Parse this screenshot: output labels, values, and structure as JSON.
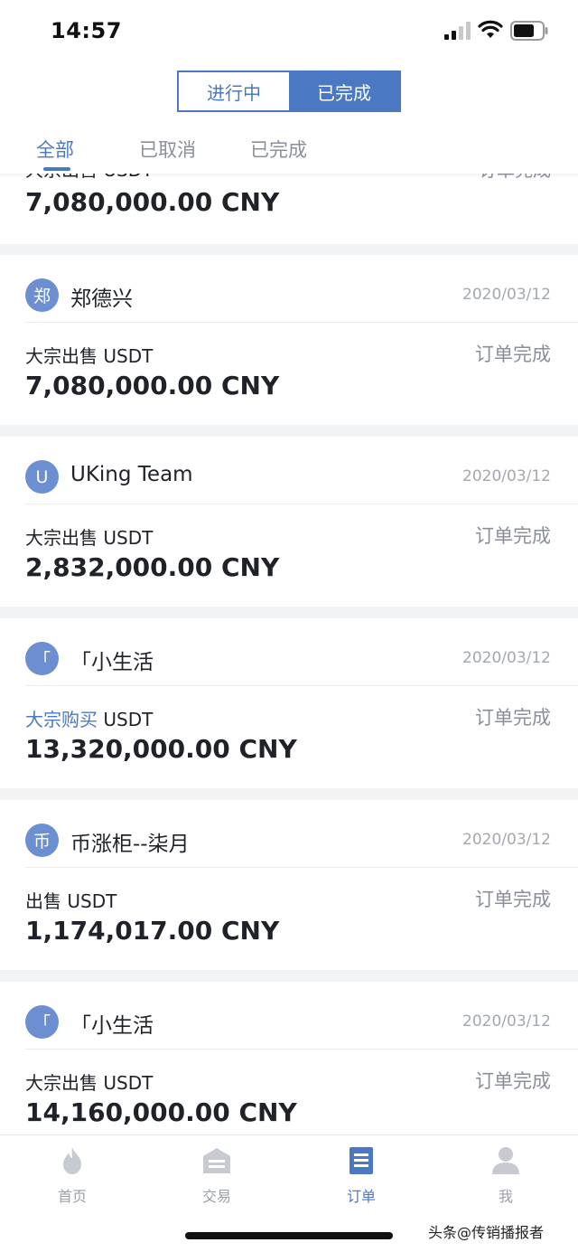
{
  "status_bar": {
    "time": "14:57"
  },
  "segment": {
    "in_progress": "进行中",
    "completed": "已完成"
  },
  "filter_tabs": {
    "all": "全部",
    "cancelled": "已取消",
    "completed": "已完成"
  },
  "partial_order": {
    "type": "大宗出售 USDT",
    "status": "订单完成",
    "amount": "7,080,000.00 CNY"
  },
  "orders": [
    {
      "avatar": "郑",
      "name": "郑德兴",
      "date": "2020/03/12",
      "action": "大宗出售",
      "asset": " USDT",
      "status": "订单完成",
      "amount": "7,080,000.00 CNY"
    },
    {
      "avatar": "U",
      "name": "UKing Team",
      "date": "2020/03/12",
      "action": "大宗出售",
      "asset": " USDT",
      "status": "订单完成",
      "amount": "2,832,000.00 CNY"
    },
    {
      "avatar": "「",
      "name": "「小生活",
      "date": "2020/03/12",
      "action": "大宗购买",
      "asset": " USDT",
      "status": "订单完成",
      "amount": "13,320,000.00 CNY"
    },
    {
      "avatar": "币",
      "name": "币涨柜--柒月",
      "date": "2020/03/12",
      "action": "出售",
      "asset": " USDT",
      "status": "订单完成",
      "amount": "1,174,017.00 CNY"
    },
    {
      "avatar": "「",
      "name": "「小生活",
      "date": "2020/03/12",
      "action": "大宗出售",
      "asset": " USDT",
      "status": "订单完成",
      "amount": "14,160,000.00 CNY"
    }
  ],
  "bottom_nav": {
    "home": "首页",
    "trade": "交易",
    "orders": "订单",
    "me": "我"
  },
  "watermark": "头条@传销播报者",
  "colors": {
    "accent": "#4a78c2",
    "avatar": "#6b8fd1"
  }
}
